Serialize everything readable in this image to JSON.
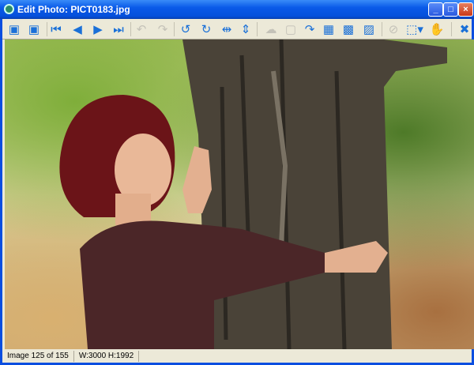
{
  "window": {
    "title": "Edit Photo: PICT0183.jpg",
    "minimize": "_",
    "maximize": "□",
    "close": "×"
  },
  "toolbar": [
    {
      "name": "save-as-icon",
      "glyph": "▣",
      "enabled": true
    },
    {
      "name": "save-close-icon",
      "glyph": "▣",
      "enabled": true
    },
    {
      "name": "first-image-icon",
      "glyph": "⏮",
      "enabled": true
    },
    {
      "name": "previous-image-icon",
      "glyph": "◀",
      "enabled": true
    },
    {
      "name": "next-image-icon",
      "glyph": "▶",
      "enabled": true
    },
    {
      "name": "last-image-icon",
      "glyph": "⏭",
      "enabled": true
    },
    {
      "name": "undo-icon",
      "glyph": "↶",
      "enabled": false
    },
    {
      "name": "redo-icon",
      "glyph": "↷",
      "enabled": false
    },
    {
      "name": "rotate-left-icon",
      "glyph": "↺",
      "enabled": true
    },
    {
      "name": "rotate-right-icon",
      "glyph": "↻",
      "enabled": true
    },
    {
      "name": "flip-horizontal-icon",
      "glyph": "⇹",
      "enabled": true
    },
    {
      "name": "flip-vertical-icon",
      "glyph": "⇕",
      "enabled": true
    },
    {
      "name": "red-eye-icon",
      "glyph": "☁",
      "enabled": false
    },
    {
      "name": "crop-icon",
      "glyph": "▢",
      "enabled": false
    },
    {
      "name": "auto-fix-icon",
      "glyph": "↷",
      "enabled": true
    },
    {
      "name": "resize-icon",
      "glyph": "▦",
      "enabled": true
    },
    {
      "name": "grayscale-icon",
      "glyph": "▩",
      "enabled": true
    },
    {
      "name": "adjust-image-icon",
      "glyph": "▨",
      "enabled": true
    },
    {
      "name": "clear-selection-icon",
      "glyph": "⊘",
      "enabled": false
    },
    {
      "name": "selection-tool-icon",
      "glyph": "⬚▾",
      "enabled": true
    },
    {
      "name": "hand-tool-icon",
      "glyph": "✋",
      "enabled": false
    },
    {
      "name": "close-editor-icon",
      "glyph": "✖",
      "enabled": true
    }
  ],
  "status": {
    "position": "Image 125 of 155",
    "dimensions": "W:3000 H:1992"
  }
}
